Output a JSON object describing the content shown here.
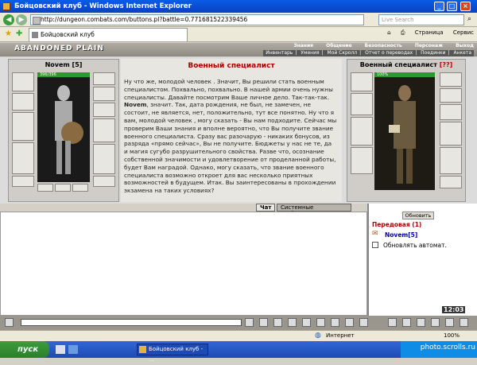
{
  "window": {
    "title": "Бойцовский клуб - Windows Internet Explorer"
  },
  "browser": {
    "url": "http://dungeon.combats.com/buttons.pl?battle=0.771681522339456",
    "search_placeholder": "Live Search",
    "tab_title": "Бойцовский клуб",
    "tools": [
      "Страница",
      "Сервис"
    ]
  },
  "game": {
    "logo": "ABANDONED PLAIN",
    "menu_top": [
      "Знания",
      "Общение",
      "Безопасность",
      "Персонаж",
      "Выход"
    ],
    "menu_bottom": [
      "Инвентарь",
      "Умения",
      "Мой Скролл",
      "Отчет о переводах",
      "Поединки",
      "Анкета"
    ]
  },
  "player": {
    "name": "Novem",
    "level": "[5]",
    "hp": "396/396",
    "hp_fraction": 1.0
  },
  "npc": {
    "name": "Военный специалист",
    "level": "[??]",
    "hp": "100%",
    "hp_fraction": 1.0
  },
  "dialog": {
    "title": "Военный специалист",
    "text_before_name": "Ну что же, молодой человек . Значит, Вы решили стать военным специалистом. Похвально, похвально. В нашей армии очень нужны специалисты. Давайте посмотрим Ваше личное дело. Так-так-так. ",
    "name": "Novem",
    "text_after_name": ", значит. Так, дата рождения, не был, не замечен, не состоит, не является, нет, положительно, тут все понятно. Ну что я вам, молодой человек , могу сказать - Вы нам подходите. Сейчас мы проверим Ваши знания и вполне вероятно, что Вы получите звание военного специалиста. Сразу вас разочарую - никаких бонусов, из разряда «прямо сейчас», Вы не получите. Бюджеты у нас не те, да и магия сугубо разрушительного свойства. Разве что, осознание собственной значимости и удовлетворение от проделанной работы, будет Вам наградой. Однако, могу сказать, что звание военного специалиста возможно откроет для вас несколько приятных возможностей в будущем. Итак. Вы заинтересованы в прохождении экзамена на таких условиях?"
  },
  "chat": {
    "tabs": [
      "Чат",
      "Системные сообщения"
    ]
  },
  "right": {
    "refresh_label": "Обновить",
    "location": "Передовая (1)",
    "user": "Novem",
    "user_level": "[5]",
    "auto_label": "Обновлять автомат."
  },
  "clock": "12:03",
  "status": {
    "zone": "Интернет",
    "zoom": "100%"
  },
  "taskbar": {
    "start": "пуск",
    "task": "Бойцовский клуб - ..."
  },
  "watermark": "photo.scrolls.ru"
}
